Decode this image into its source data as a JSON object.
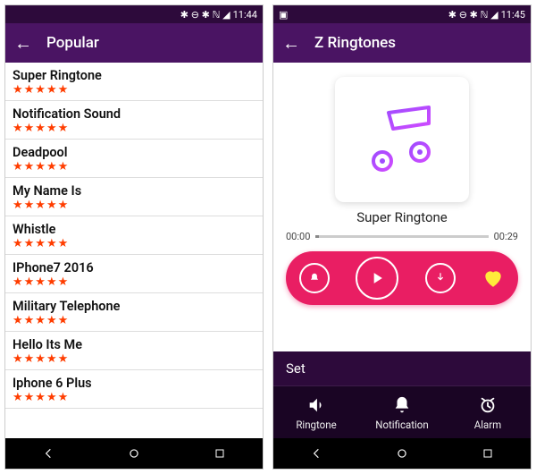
{
  "left": {
    "status": {
      "time": "11:44",
      "icons": "✱ ⊖ ✱ ℕ ◢"
    },
    "appbar": {
      "title": "Popular"
    },
    "items": [
      {
        "name": "Super Ringtone"
      },
      {
        "name": "Notification Sound"
      },
      {
        "name": "Deadpool"
      },
      {
        "name": "My Name Is"
      },
      {
        "name": "Whistle"
      },
      {
        "name": "IPhone7  2016"
      },
      {
        "name": "Military Telephone"
      },
      {
        "name": "Hello Its Me"
      },
      {
        "name": "Iphone 6 Plus"
      }
    ]
  },
  "right": {
    "status": {
      "time": "11:45",
      "left_icon": "▣",
      "icons": "✱ ⊖ ✱ ℕ ◢"
    },
    "appbar": {
      "title": "Z Ringtones"
    },
    "track": {
      "title": "Super Ringtone"
    },
    "time": {
      "current": "00:00",
      "total": "00:29"
    },
    "set": {
      "header": "Set",
      "ringtone": "Ringtone",
      "notification": "Notification",
      "alarm": "Alarm"
    }
  },
  "stars": "★★★★★"
}
